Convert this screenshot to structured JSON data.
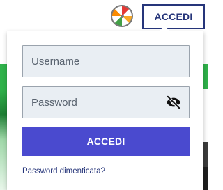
{
  "header": {
    "wheel_icon": "prize-wheel-icon",
    "login_label": "ACCEDI"
  },
  "login_dropdown": {
    "username": {
      "placeholder": "Username",
      "value": ""
    },
    "password": {
      "placeholder": "Password",
      "value": "",
      "toggle_icon": "eye-slash-icon"
    },
    "submit_label": "ACCEDI",
    "forgot_password_label": "Password dimenticata?"
  },
  "colors": {
    "brand_navy": "#26357a",
    "submit_blue": "#4a4acf",
    "field_background": "#e9eef3",
    "accent_green": "#2fb24a"
  }
}
